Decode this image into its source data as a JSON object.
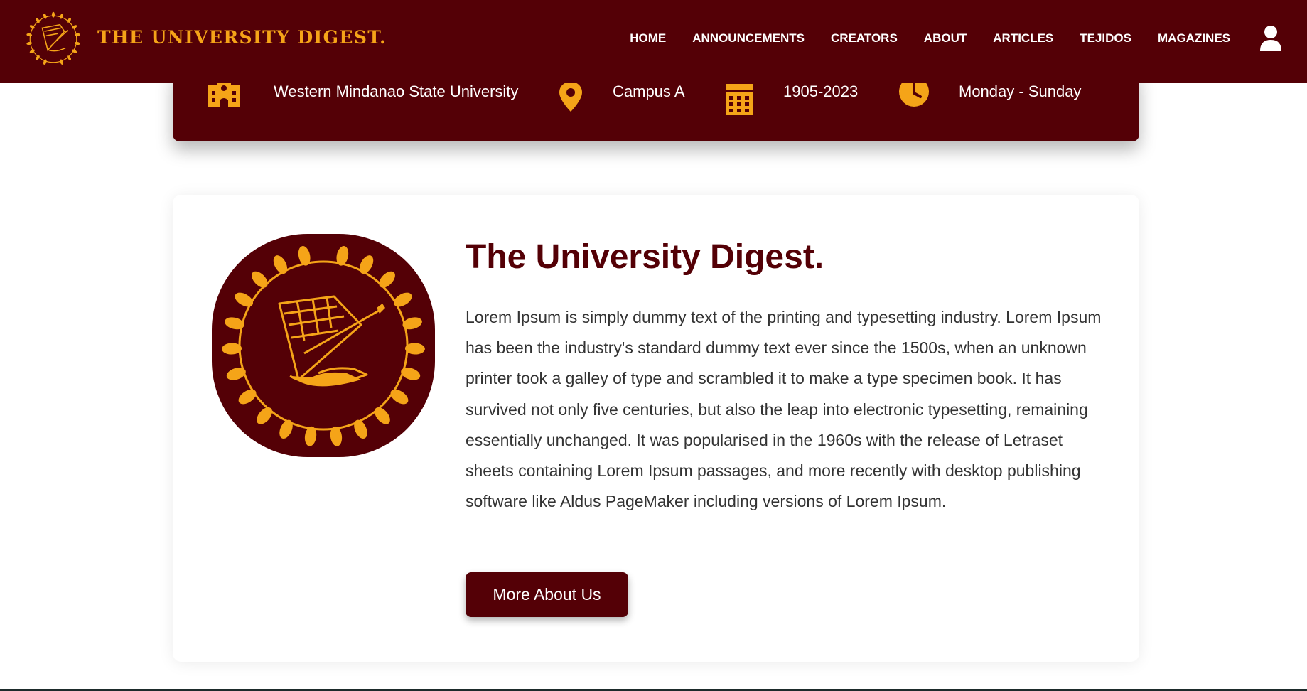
{
  "navbar": {
    "brand_title": "THE UNIVERSITY DIGEST.",
    "links": [
      "HOME",
      "ANNOUNCEMENTS",
      "CREATORS",
      "ABOUT",
      "ARTICLES",
      "TEJIDOS",
      "MAGAZINES"
    ]
  },
  "info_bar": {
    "items": [
      {
        "icon": "building-icon",
        "text": "Western Mindanao State University"
      },
      {
        "icon": "location-pin-icon",
        "text": "Campus A"
      },
      {
        "icon": "calendar-icon",
        "text": "1905-2023"
      },
      {
        "icon": "clock-icon",
        "text": "Monday - Sunday"
      }
    ]
  },
  "about": {
    "title": "The University Digest.",
    "body": "Lorem Ipsum is simply dummy text of the printing and typesetting industry. Lorem Ipsum has been the industry's standard dummy text ever since the 1500s, when an unknown printer took a galley of type and scrambled it to make a type specimen book. It has survived not only five centuries, but also the leap into electronic typesetting, remaining essentially unchanged. It was popularised in the 1960s with the release of Letraset sheets containing Lorem Ipsum passages, and more recently with desktop publishing software like Aldus PageMaker including versions of Lorem Ipsum.",
    "button_label": "More About Us"
  },
  "colors": {
    "maroon": "#540006",
    "gold": "#f5a418",
    "text": "#333333"
  }
}
